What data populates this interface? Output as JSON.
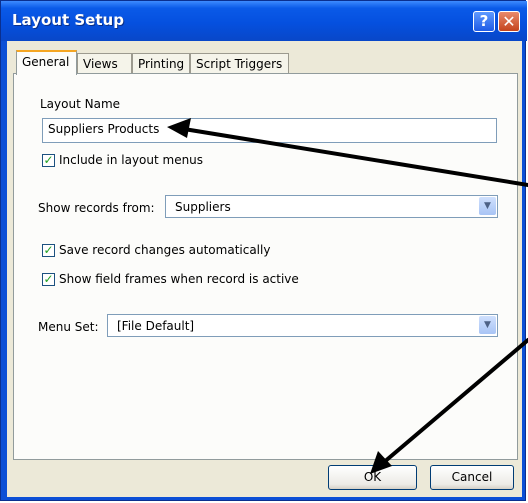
{
  "window": {
    "title": "Layout Setup",
    "help_glyph": "?",
    "close_glyph": "✕"
  },
  "tabs": [
    {
      "label": "General",
      "active": true
    },
    {
      "label": "Views",
      "active": false
    },
    {
      "label": "Printing",
      "active": false
    },
    {
      "label": "Script Triggers",
      "active": false
    }
  ],
  "general": {
    "layout_name_label": "Layout Name",
    "layout_name_value": "Suppliers Products",
    "include_in_menus": {
      "label": "Include in layout menus",
      "checked": true
    },
    "show_records_label": "Show records from:",
    "show_records_value": "Suppliers",
    "save_changes": {
      "label": "Save record changes automatically",
      "checked": true
    },
    "show_field_frames": {
      "label": "Show field frames when record is active",
      "checked": true
    },
    "menu_set_label": "Menu Set:",
    "menu_set_value": "[File Default]"
  },
  "buttons": {
    "ok": "OK",
    "cancel": "Cancel"
  },
  "glyphs": {
    "checkmark": "✓",
    "dropdown": "▼"
  },
  "colors": {
    "titlebar": "#0550df",
    "dialog_bg": "#ece9d8",
    "tab_highlight": "#f5a623",
    "annotation_arrow": "#000000"
  }
}
